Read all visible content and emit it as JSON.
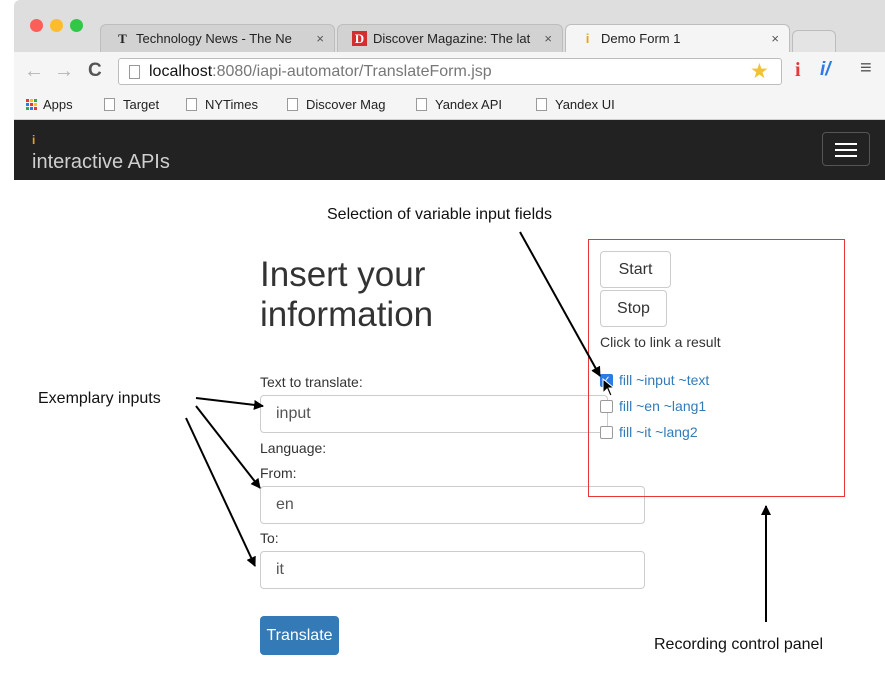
{
  "browser": {
    "window_dots": [
      "#fc5f57",
      "#fdbc2e",
      "#33c748"
    ],
    "tabs": [
      {
        "title": "Technology News - The Ne",
        "favicon": "T",
        "active": false
      },
      {
        "title": "Discover Magazine: The lat",
        "favicon": "D",
        "active": false
      },
      {
        "title": "Demo Form 1",
        "favicon": "i",
        "active": true
      }
    ],
    "url_host": "localhost",
    "url_rest": ":8080/iapi-automator/TranslateForm.jsp",
    "bookmarks": [
      "Apps",
      "Target",
      "NYTimes",
      "Discover Mag",
      "Yandex API",
      "Yandex UI"
    ]
  },
  "app": {
    "brand_mark": "i",
    "brand": "interactive APIs",
    "heading_line1": "Insert your",
    "heading_line2": "information",
    "text_label": "Text to translate:",
    "text_value": "input",
    "language_label": "Language:",
    "from_label": "From:",
    "from_value": "en",
    "to_label": "To:",
    "to_value": "it",
    "translate_label": "Translate",
    "accent_color": "#337ab7"
  },
  "panel": {
    "start_label": "Start",
    "stop_label": "Stop",
    "hint": "Click to link a result",
    "checks": [
      {
        "label": "fill ~input ~text",
        "checked": true
      },
      {
        "label": "fill ~en ~lang1",
        "checked": false
      },
      {
        "label": "fill ~it ~lang2",
        "checked": false
      }
    ],
    "border_color": "#e53935"
  },
  "annotations": {
    "variable_fields": "Selection of variable input fields",
    "exemplary": "Exemplary inputs",
    "recording": "Recording control panel"
  }
}
